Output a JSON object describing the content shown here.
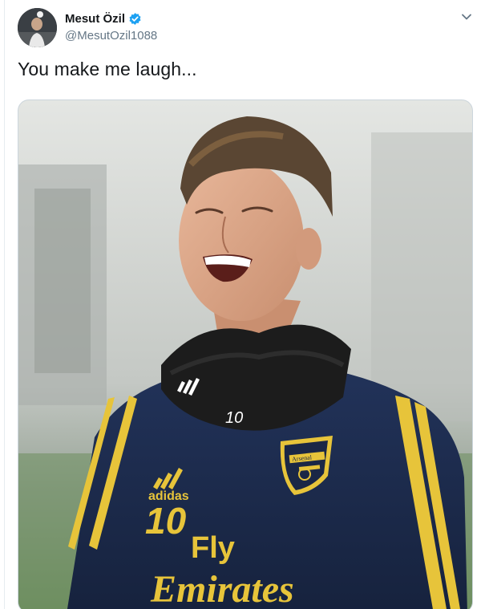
{
  "tweet": {
    "author_name": "Mesut Özil",
    "author_handle": "@MesutOzil1088",
    "text": "You make me laugh...",
    "verified": true
  },
  "icons": {
    "avatar": "avatar-photo",
    "verified": "verified-badge-icon",
    "menu": "chevron-down-icon"
  },
  "photo": {
    "jersey_brand": "adidas",
    "jersey_number": "10",
    "sponsor_line1": "Fly",
    "sponsor_line2": "Emirates",
    "club_crest": "Arsenal",
    "collar_number": "10"
  },
  "colors": {
    "verified_blue": "#1da1f2",
    "handle_gray": "#657786",
    "jersey_navy": "#1a2746",
    "jersey_yellow": "#e7c43a"
  }
}
